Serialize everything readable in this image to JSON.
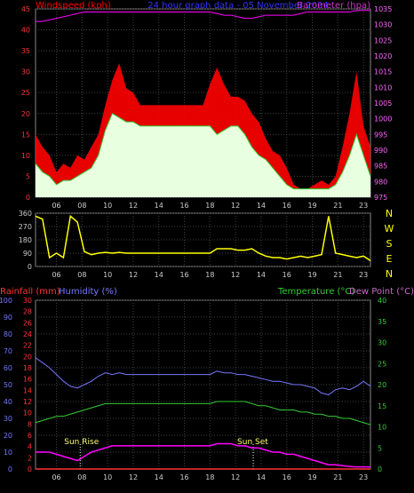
{
  "title": "24 hour graph data - 05 November 2024",
  "colors": {
    "wind": "#ff0000",
    "gust": "#ff0000",
    "wind_avg": "#33cc33",
    "wind_fill": "#e8ffe0",
    "barometer": "#ff00ff",
    "direction": "#ffff00",
    "humidity": "#7777ff",
    "temperature": "#33cc33",
    "dewpoint": "#ff00ff",
    "rainfall": "#ff3333",
    "grid": "#404040",
    "axis_text": "#cccccc",
    "title": "#3333ff"
  },
  "time_ticks": [
    "06",
    "08",
    "10",
    "12",
    "14",
    "16",
    "18",
    "12",
    "14",
    "16",
    "19",
    "21",
    "23"
  ],
  "chart_data": [
    {
      "type": "line",
      "name": "wind-barometer",
      "ylabel_left": "Windspeed (kph)",
      "ylabel_right": "Barometer (hpa)",
      "ylim_left": [
        0,
        45
      ],
      "yticks_left": [
        "0",
        "5",
        "10",
        "15",
        "20",
        "25",
        "30",
        "35",
        "40",
        "45"
      ],
      "ylim_right": [
        975,
        1035
      ],
      "yticks_right": [
        "975",
        "980",
        "985",
        "990",
        "995",
        "1000",
        "1005",
        "1010",
        "1015",
        "1020",
        "1025",
        "1030",
        "1035"
      ],
      "x": [
        0,
        0.5,
        1,
        1.5,
        2,
        2.5,
        3,
        3.5,
        4,
        4.5,
        5,
        5.5,
        6,
        6.5,
        7,
        7.5,
        8,
        8.5,
        9,
        9.5,
        10,
        10.5,
        11,
        11.5,
        12,
        12.5,
        13,
        13.5,
        14,
        14.5,
        15,
        15.5,
        16,
        16.5,
        17,
        17.5,
        18,
        18.5,
        19,
        19.5,
        20,
        20.5,
        21,
        21.5,
        22,
        22.5,
        23,
        23.5,
        24
      ],
      "series": [
        {
          "name": "gust",
          "values": [
            15,
            12,
            10,
            6,
            8,
            7,
            10,
            9,
            12,
            15,
            22,
            28,
            32,
            26,
            25,
            22,
            22,
            22,
            22,
            22,
            22,
            22,
            22,
            22,
            22,
            27,
            31,
            27,
            24,
            24,
            23,
            20,
            18,
            14,
            11,
            10,
            7,
            3,
            2,
            2,
            3,
            4,
            3,
            5,
            12,
            20,
            30,
            17,
            12
          ]
        },
        {
          "name": "average",
          "values": [
            8,
            6,
            5,
            3,
            4,
            4,
            5,
            6,
            7,
            10,
            16,
            20,
            19,
            18,
            18,
            17,
            17,
            17,
            17,
            17,
            17,
            17,
            17,
            17,
            17,
            17,
            15,
            16,
            17,
            17,
            15,
            12,
            10,
            9,
            7,
            5,
            3,
            2,
            2,
            2,
            2,
            2,
            2,
            3,
            6,
            10,
            15,
            10,
            5
          ]
        },
        {
          "name": "barometer",
          "values": [
            1031,
            1031,
            1031.5,
            1032,
            1032.5,
            1033,
            1033.5,
            1034,
            1034,
            1034,
            1034,
            1034,
            1034,
            1034,
            1034,
            1034,
            1034,
            1034,
            1034,
            1034,
            1034,
            1034,
            1034,
            1034,
            1034,
            1034,
            1033.5,
            1033,
            1033,
            1032.5,
            1032,
            1032,
            1032.5,
            1033,
            1033,
            1033,
            1033,
            1033,
            1033.5,
            1034,
            1034,
            1034,
            1034,
            1034,
            1034,
            1034,
            1034.5,
            1034.5,
            1034.5
          ]
        }
      ]
    },
    {
      "type": "line",
      "name": "wind-direction",
      "ylim": [
        0,
        360
      ],
      "yticks": [
        "0",
        "90",
        "180",
        "270",
        "360"
      ],
      "compass_labels": [
        "N",
        "W",
        "S",
        "E",
        "N"
      ],
      "x": [
        0,
        0.5,
        1,
        1.5,
        2,
        2.5,
        3,
        3.5,
        4,
        4.5,
        5,
        5.5,
        6,
        6.5,
        7,
        7.5,
        8,
        8.5,
        9,
        9.5,
        10,
        10.5,
        11,
        11.5,
        12,
        12.5,
        13,
        13.5,
        14,
        14.5,
        15,
        15.5,
        16,
        16.5,
        17,
        17.5,
        18,
        18.5,
        19,
        19.5,
        20,
        20.5,
        21,
        21.5,
        22,
        22.5,
        23,
        23.5,
        24
      ],
      "series": [
        {
          "name": "direction",
          "values": [
            340,
            320,
            60,
            90,
            60,
            340,
            300,
            100,
            80,
            90,
            95,
            90,
            95,
            90,
            90,
            90,
            90,
            90,
            90,
            90,
            90,
            90,
            90,
            90,
            90,
            90,
            120,
            120,
            120,
            110,
            110,
            120,
            90,
            70,
            60,
            60,
            50,
            60,
            70,
            60,
            70,
            80,
            340,
            90,
            80,
            70,
            60,
            70,
            40
          ]
        }
      ]
    },
    {
      "type": "line",
      "name": "temp-humidity-rain",
      "ylabel_rain": "Rainfall (mm)",
      "ylabel_humidity": "Humidity (%)",
      "ylabel_temp": "Temperature (°C)",
      "ylabel_dew": "Dew Point (°C)",
      "ylim_humidity": [
        0,
        100
      ],
      "yticks_humidity": [
        "0",
        "10",
        "20",
        "30",
        "40",
        "50",
        "60",
        "70",
        "80",
        "90",
        "100"
      ],
      "ylim_rain": [
        0,
        30
      ],
      "yticks_rain": [
        "0",
        "2",
        "4",
        "6",
        "8",
        "10",
        "12",
        "14",
        "16",
        "18",
        "20",
        "22",
        "24",
        "26",
        "28",
        "30"
      ],
      "ylim_temp": [
        0,
        40
      ],
      "yticks_temp": [
        "0",
        "5",
        "10",
        "15",
        "20",
        "25",
        "30",
        "35",
        "40"
      ],
      "annotations": [
        "Sun Rise",
        "Sun Set"
      ],
      "x": [
        0,
        0.5,
        1,
        1.5,
        2,
        2.5,
        3,
        3.5,
        4,
        4.5,
        5,
        5.5,
        6,
        6.5,
        7,
        7.5,
        8,
        8.5,
        9,
        9.5,
        10,
        10.5,
        11,
        11.5,
        12,
        12.5,
        13,
        13.5,
        14,
        14.5,
        15,
        15.5,
        16,
        16.5,
        17,
        17.5,
        18,
        18.5,
        19,
        19.5,
        20,
        20.5,
        21,
        21.5,
        22,
        22.5,
        23,
        23.5,
        24
      ],
      "series": [
        {
          "name": "humidity",
          "values": [
            66,
            63,
            60,
            56,
            52,
            49,
            48,
            50,
            52,
            55,
            57,
            56,
            57,
            56,
            56,
            56,
            56,
            56,
            56,
            56,
            56,
            56,
            56,
            56,
            56,
            56,
            58,
            57,
            57,
            56,
            56,
            55,
            54,
            53,
            52,
            52,
            51,
            50,
            50,
            49,
            48,
            45,
            44,
            47,
            48,
            47,
            49,
            52,
            49
          ]
        },
        {
          "name": "temperature",
          "values": [
            11,
            11.5,
            12,
            12.5,
            12.5,
            13,
            13.5,
            14,
            14.5,
            15,
            15.5,
            15.5,
            15.5,
            15.5,
            15.5,
            15.5,
            15.5,
            15.5,
            15.5,
            15.5,
            15.5,
            15.5,
            15.5,
            15.5,
            15.5,
            15.5,
            16,
            16,
            16,
            16,
            16,
            15.5,
            15,
            15,
            14.5,
            14,
            14,
            14,
            13.5,
            13.5,
            13,
            13,
            12.5,
            12.5,
            12,
            12,
            11.5,
            11,
            10.5
          ]
        },
        {
          "name": "dewpoint",
          "values": [
            4,
            4,
            4,
            3.5,
            3,
            2.5,
            2,
            3,
            4,
            4.5,
            5,
            5.5,
            5.5,
            5.5,
            5.5,
            5.5,
            5.5,
            5.5,
            5.5,
            5.5,
            5.5,
            5.5,
            5.5,
            5.5,
            5.5,
            5.5,
            6,
            6,
            6,
            5.5,
            5.5,
            5,
            5,
            4.5,
            4,
            4,
            3.5,
            3.5,
            3,
            2.5,
            2,
            1.5,
            1,
            1,
            0.8,
            0.6,
            0.5,
            0.5,
            0.5
          ]
        },
        {
          "name": "rainfall",
          "values": [
            0,
            0,
            0,
            0,
            0,
            0,
            0,
            0,
            0,
            0,
            0,
            0,
            0,
            0,
            0,
            0,
            0,
            0,
            0,
            0,
            0,
            0,
            0,
            0,
            0,
            0,
            0,
            0,
            0,
            0,
            0,
            0,
            0,
            0,
            0,
            0,
            0,
            0,
            0,
            0,
            0,
            0,
            0,
            0,
            0,
            0,
            0,
            0,
            0
          ]
        }
      ]
    }
  ]
}
